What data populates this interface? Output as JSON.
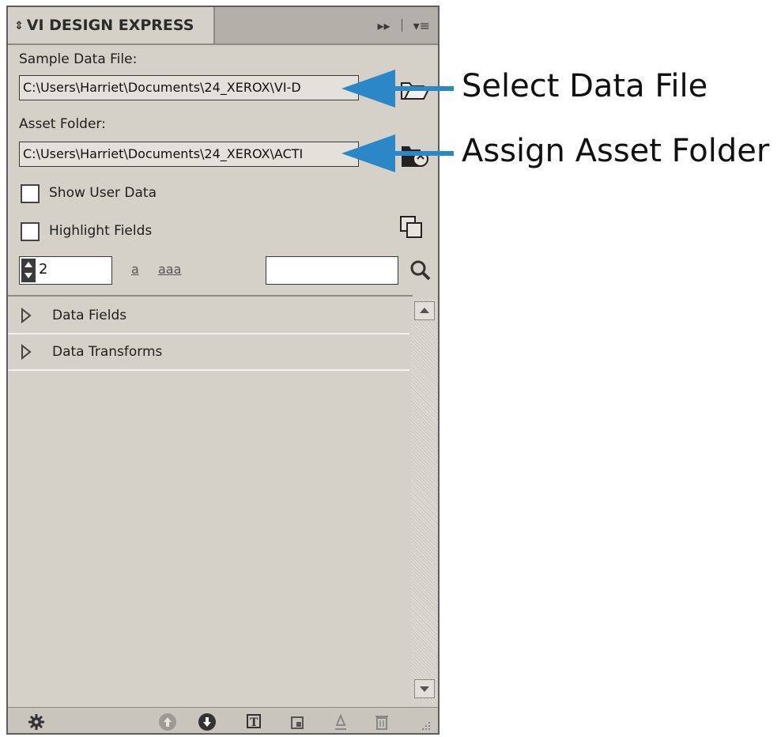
{
  "panel": {
    "title": "VI DESIGN EXPRESS",
    "sample_data_label": "Sample Data File:",
    "sample_data_path": "C:\\Users\\Harriet\\Documents\\24_XEROX\\VI-D",
    "asset_folder_label": "Asset Folder:",
    "asset_folder_path": "C:\\Users\\Harriet\\Documents\\24_XEROX\\ACTI",
    "show_user_data_label": "Show User Data",
    "highlight_fields_label": "Highlight Fields",
    "record_number": "2",
    "single_char_option": "a",
    "multi_char_option": "aaa",
    "search_value": "",
    "tree_items": [
      {
        "label": "Data Fields"
      },
      {
        "label": "Data Transforms"
      }
    ]
  },
  "annotations": {
    "select_data_file": "Select Data File",
    "assign_asset_folder": "Assign Asset Folder"
  },
  "colors": {
    "panel_bg": "#d5d1c8",
    "header_bg": "#b3b0a9",
    "arrow": "#2c87c9"
  },
  "icons": [
    "sort-arrows-icon",
    "fast-forward-icon",
    "panel-menu-icon",
    "open-folder-icon",
    "asset-folder-icon",
    "duplicate-frames-icon",
    "search-icon",
    "expand-triangle-icon",
    "gear-icon",
    "move-up-icon",
    "move-down-icon",
    "text-frame-icon",
    "graphic-frame-icon",
    "fill-icon",
    "trash-icon",
    "resize-grip-icon"
  ]
}
